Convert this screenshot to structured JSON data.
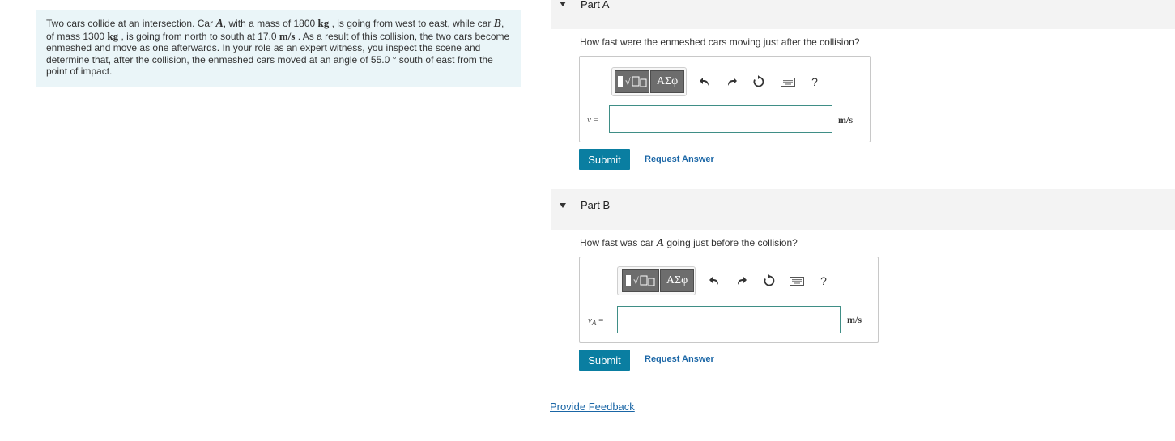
{
  "problem": {
    "segments": [
      {
        "t": "Two cars collide at an intersection. Car ",
        "s": "n"
      },
      {
        "t": "A",
        "s": "i"
      },
      {
        "t": ", with a mass of 1800 ",
        "s": "n"
      },
      {
        "t": "kg",
        "s": "m"
      },
      {
        "t": " , is going from west to east, while car ",
        "s": "n"
      },
      {
        "t": "B",
        "s": "i"
      },
      {
        "t": ", of mass 1300 ",
        "s": "n"
      },
      {
        "t": "kg",
        "s": "m"
      },
      {
        "t": " , is going from north to south at 17.0 ",
        "s": "n"
      },
      {
        "t": "m/s",
        "s": "m"
      },
      {
        "t": " . As a result of this collision, the two cars become enmeshed and move as one afterwards. In your role as an expert witness, you inspect the scene and determine that, after the collision, the enmeshed cars moved at an angle of 55.0 ° south of east from the point of impact.",
        "s": "n"
      }
    ]
  },
  "parts": [
    {
      "title": "Part A",
      "question": "How fast were the enmeshed cars moving just after the collision?",
      "var_label": "v =",
      "value": "",
      "unit": "m/s",
      "submit_label": "Submit",
      "request_label": "Request Answer"
    },
    {
      "title": "Part B",
      "question_pre": "How fast was car ",
      "question_var": "A",
      "question_post": " going just before the collision?",
      "var_label": "v",
      "var_sub": "A",
      "var_eq": " =",
      "value": "",
      "unit": "m/s",
      "submit_label": "Submit",
      "request_label": "Request Answer"
    }
  ],
  "toolbar": {
    "templates_icon": "templates-icon",
    "symbols_label": "ΑΣφ",
    "undo_icon": "undo-icon",
    "redo_icon": "redo-icon",
    "reset_icon": "reset-icon",
    "keyboard_icon": "keyboard-icon",
    "help_label": "?"
  },
  "feedback_label": "Provide Feedback"
}
